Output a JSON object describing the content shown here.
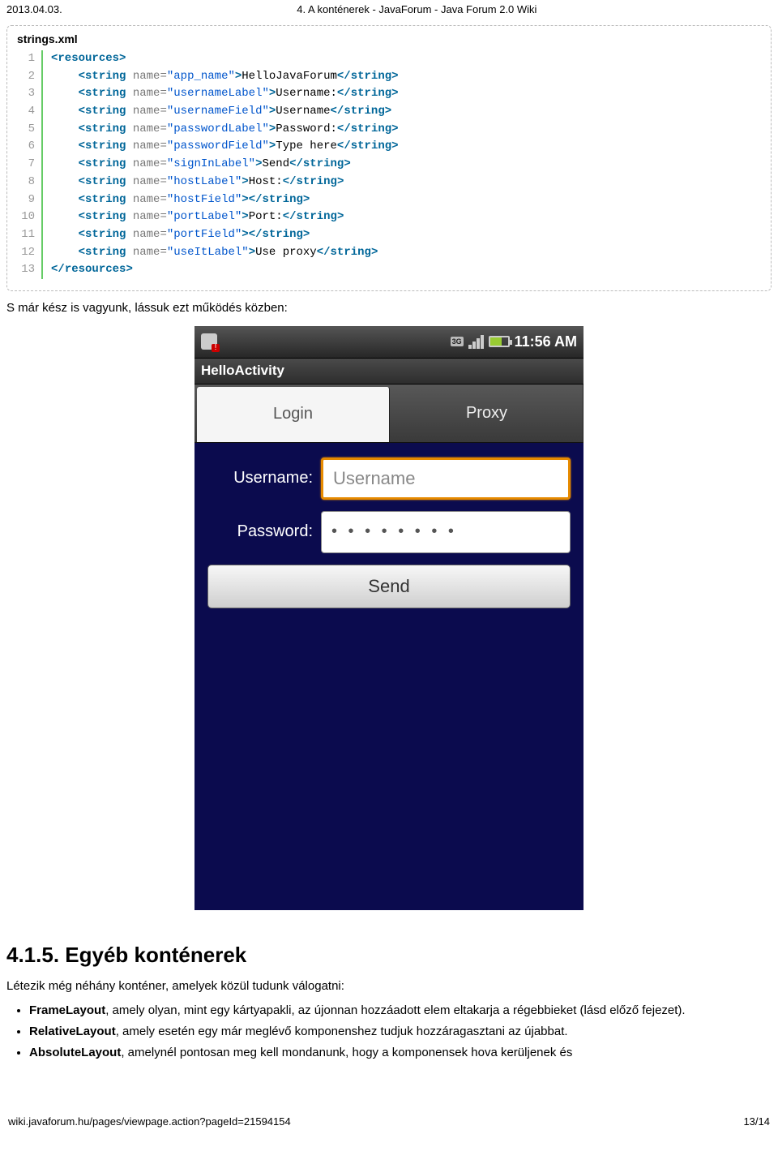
{
  "header": {
    "date": "2013.04.03.",
    "title": "4. A konténerek - JavaForum - Java Forum 2.0 Wiki"
  },
  "codePanel": {
    "title": "strings.xml",
    "lines": [
      {
        "n": 1,
        "tokens": [
          [
            "punc",
            "<"
          ],
          [
            "tag",
            "resources"
          ],
          [
            "punc",
            ">"
          ]
        ]
      },
      {
        "n": 2,
        "indent": 4,
        "tokens": [
          [
            "punc",
            "<"
          ],
          [
            "tag",
            "string"
          ],
          [
            "attr",
            " name="
          ],
          [
            "str",
            "\"app_name\""
          ],
          [
            "punc",
            ">"
          ],
          [
            "text",
            "HelloJavaForum"
          ],
          [
            "punc",
            "</"
          ],
          [
            "tag",
            "string"
          ],
          [
            "punc",
            ">"
          ]
        ]
      },
      {
        "n": 3,
        "indent": 4,
        "tokens": [
          [
            "punc",
            "<"
          ],
          [
            "tag",
            "string"
          ],
          [
            "attr",
            " name="
          ],
          [
            "str",
            "\"usernameLabel\""
          ],
          [
            "punc",
            ">"
          ],
          [
            "text",
            "Username:"
          ],
          [
            "punc",
            "</"
          ],
          [
            "tag",
            "string"
          ],
          [
            "punc",
            ">"
          ]
        ]
      },
      {
        "n": 4,
        "indent": 4,
        "tokens": [
          [
            "punc",
            "<"
          ],
          [
            "tag",
            "string"
          ],
          [
            "attr",
            " name="
          ],
          [
            "str",
            "\"usernameField\""
          ],
          [
            "punc",
            ">"
          ],
          [
            "text",
            "Username"
          ],
          [
            "punc",
            "</"
          ],
          [
            "tag",
            "string"
          ],
          [
            "punc",
            ">"
          ]
        ]
      },
      {
        "n": 5,
        "indent": 4,
        "tokens": [
          [
            "punc",
            "<"
          ],
          [
            "tag",
            "string"
          ],
          [
            "attr",
            " name="
          ],
          [
            "str",
            "\"passwordLabel\""
          ],
          [
            "punc",
            ">"
          ],
          [
            "text",
            "Password:"
          ],
          [
            "punc",
            "</"
          ],
          [
            "tag",
            "string"
          ],
          [
            "punc",
            ">"
          ]
        ]
      },
      {
        "n": 6,
        "indent": 4,
        "tokens": [
          [
            "punc",
            "<"
          ],
          [
            "tag",
            "string"
          ],
          [
            "attr",
            " name="
          ],
          [
            "str",
            "\"passwordField\""
          ],
          [
            "punc",
            ">"
          ],
          [
            "text",
            "Type here"
          ],
          [
            "punc",
            "</"
          ],
          [
            "tag",
            "string"
          ],
          [
            "punc",
            ">"
          ]
        ]
      },
      {
        "n": 7,
        "indent": 4,
        "tokens": [
          [
            "punc",
            "<"
          ],
          [
            "tag",
            "string"
          ],
          [
            "attr",
            " name="
          ],
          [
            "str",
            "\"signInLabel\""
          ],
          [
            "punc",
            ">"
          ],
          [
            "text",
            "Send"
          ],
          [
            "punc",
            "</"
          ],
          [
            "tag",
            "string"
          ],
          [
            "punc",
            ">"
          ]
        ]
      },
      {
        "n": 8,
        "indent": 4,
        "tokens": [
          [
            "punc",
            "<"
          ],
          [
            "tag",
            "string"
          ],
          [
            "attr",
            " name="
          ],
          [
            "str",
            "\"hostLabel\""
          ],
          [
            "punc",
            ">"
          ],
          [
            "text",
            "Host:"
          ],
          [
            "punc",
            "</"
          ],
          [
            "tag",
            "string"
          ],
          [
            "punc",
            ">"
          ]
        ]
      },
      {
        "n": 9,
        "indent": 4,
        "tokens": [
          [
            "punc",
            "<"
          ],
          [
            "tag",
            "string"
          ],
          [
            "attr",
            " name="
          ],
          [
            "str",
            "\"hostField\""
          ],
          [
            "punc",
            ">"
          ],
          [
            "punc",
            "</"
          ],
          [
            "tag",
            "string"
          ],
          [
            "punc",
            ">"
          ]
        ]
      },
      {
        "n": 10,
        "indent": 4,
        "tokens": [
          [
            "punc",
            "<"
          ],
          [
            "tag",
            "string"
          ],
          [
            "attr",
            " name="
          ],
          [
            "str",
            "\"portLabel\""
          ],
          [
            "punc",
            ">"
          ],
          [
            "text",
            "Port:"
          ],
          [
            "punc",
            "</"
          ],
          [
            "tag",
            "string"
          ],
          [
            "punc",
            ">"
          ]
        ]
      },
      {
        "n": 11,
        "indent": 4,
        "tokens": [
          [
            "punc",
            "<"
          ],
          [
            "tag",
            "string"
          ],
          [
            "attr",
            " name="
          ],
          [
            "str",
            "\"portField\""
          ],
          [
            "punc",
            ">"
          ],
          [
            "punc",
            "</"
          ],
          [
            "tag",
            "string"
          ],
          [
            "punc",
            ">"
          ]
        ]
      },
      {
        "n": 12,
        "indent": 4,
        "tokens": [
          [
            "punc",
            "<"
          ],
          [
            "tag",
            "string"
          ],
          [
            "attr",
            " name="
          ],
          [
            "str",
            "\"useItLabel\""
          ],
          [
            "punc",
            ">"
          ],
          [
            "text",
            "Use proxy"
          ],
          [
            "punc",
            "</"
          ],
          [
            "tag",
            "string"
          ],
          [
            "punc",
            ">"
          ]
        ]
      },
      {
        "n": 13,
        "tokens": [
          [
            "punc",
            "</"
          ],
          [
            "tag",
            "resources"
          ],
          [
            "punc",
            ">"
          ]
        ]
      }
    ]
  },
  "body": {
    "intro": "S már kész is vagyunk, lássuk ezt működés közben:"
  },
  "device": {
    "status": {
      "clock": "11:56 AM",
      "net": "3G"
    },
    "appTitle": "HelloActivity",
    "tabs": {
      "login": "Login",
      "proxy": "Proxy"
    },
    "form": {
      "usernameLabel": "Username:",
      "usernameValue": "Username",
      "passwordLabel": "Password:",
      "passwordDots": "• • • • • • • •",
      "sendLabel": "Send"
    }
  },
  "section": {
    "heading": "4.1.5. Egyéb konténerek",
    "lead": "Létezik még néhány konténer, amelyek közül tudunk válogatni:",
    "items": [
      {
        "bold": "FrameLayout",
        "rest": ", amely olyan, mint egy kártyapakli, az újonnan hozzáadott elem eltakarja a régebbieket (lásd előző fejezet)."
      },
      {
        "bold": "RelativeLayout",
        "rest": ", amely esetén egy már meglévő komponenshez tudjuk hozzáragasztani az újabbat."
      },
      {
        "bold": "AbsoluteLayout",
        "rest": ", amelynél pontosan meg kell mondanunk, hogy a komponensek hova kerüljenek és"
      }
    ]
  },
  "footer": {
    "url": "wiki.javaforum.hu/pages/viewpage.action?pageId=21594154",
    "page": "13/14"
  }
}
